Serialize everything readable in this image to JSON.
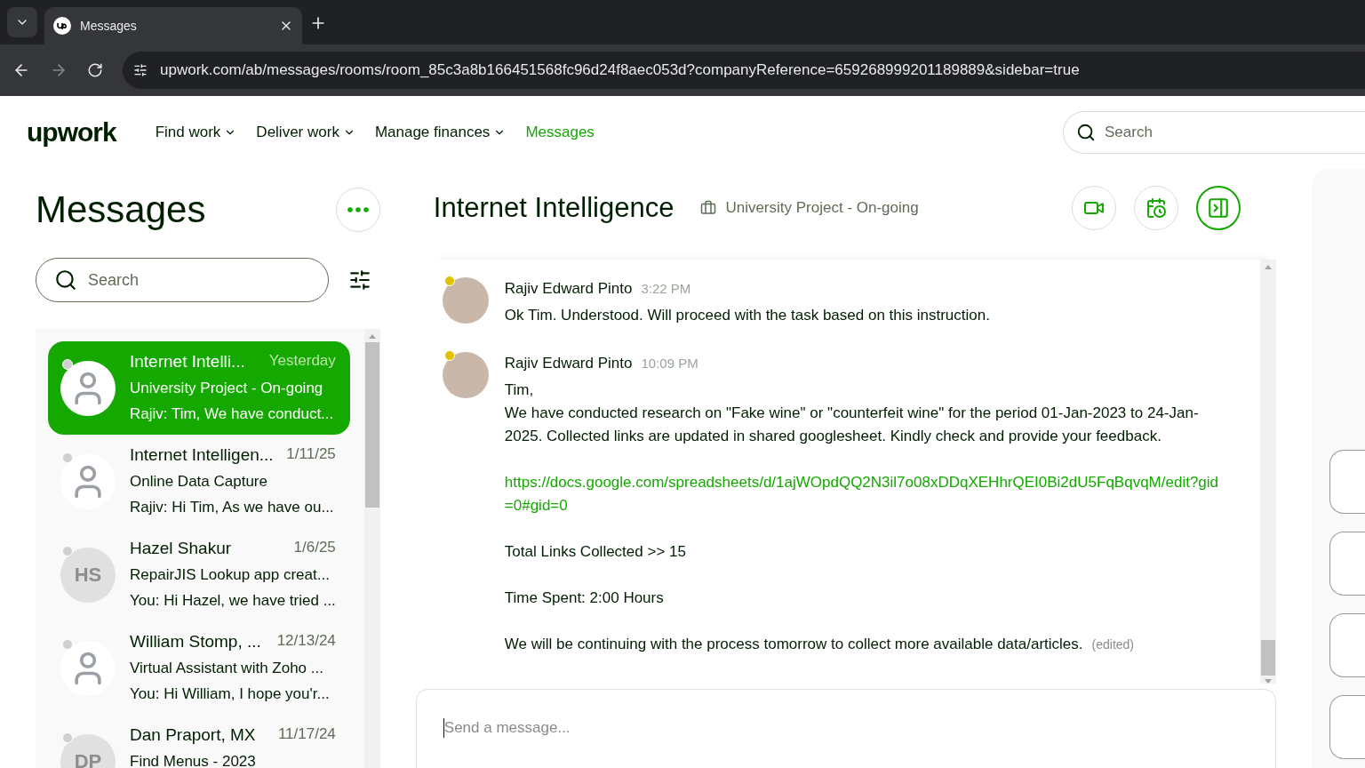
{
  "browser": {
    "tab_title": "Messages",
    "url": "upwork.com/ab/messages/rooms/room_85c3a8b166451568fc96d24f8aec053d?companyReference=659268999201189889&sidebar=true"
  },
  "nav": {
    "logo": "upwork",
    "items": [
      {
        "label": "Find work",
        "dropdown": true,
        "selected": false
      },
      {
        "label": "Deliver work",
        "dropdown": true,
        "selected": false
      },
      {
        "label": "Manage finances",
        "dropdown": true,
        "selected": false
      },
      {
        "label": "Messages",
        "dropdown": false,
        "selected": true
      }
    ],
    "search_placeholder": "Search"
  },
  "sidebar": {
    "title": "Messages",
    "search_placeholder": "Search",
    "conversations": [
      {
        "name": "Internet Intelli...",
        "date": "Yesterday",
        "title": "University Project - On-going",
        "preview": "Rajiv: Tim, We have conduct...",
        "selected": true,
        "avatar": {
          "kind": "photo"
        }
      },
      {
        "name": "Internet Intelligen...",
        "date": "1/11/25",
        "title": "Online Data Capture",
        "preview": "Rajiv: Hi Tim, As we have ou...",
        "selected": false,
        "avatar": {
          "kind": "photo"
        }
      },
      {
        "name": "Hazel Shakur",
        "date": "1/6/25",
        "title": "RepairJIS Lookup app creat...",
        "preview": "You: Hi Hazel, we have tried ...",
        "selected": false,
        "avatar": {
          "kind": "initials",
          "initials": "HS"
        }
      },
      {
        "name": "William Stomp, ...",
        "date": "12/13/24",
        "title": "Virtual Assistant with Zoho ...",
        "preview": "You: Hi William, I hope you'r...",
        "selected": false,
        "avatar": {
          "kind": "photo"
        }
      },
      {
        "name": "Dan Praport, MX",
        "date": "11/17/24",
        "title": "Find Menus - 2023",
        "selected": false,
        "avatar": {
          "kind": "initials",
          "initials": "DP"
        }
      }
    ]
  },
  "room": {
    "title": "Internet Intelligence",
    "project": "University Project - On-going",
    "messages": [
      {
        "sender": "Rajiv Edward Pinto",
        "time": "3:22 PM",
        "blocks": [
          {
            "kind": "text",
            "lines": [
              "Ok Tim. Understood. Will proceed with the task based on this instruction."
            ]
          }
        ]
      },
      {
        "sender": "Rajiv Edward Pinto",
        "time": "10:09 PM",
        "edited_label": "(edited)",
        "blocks": [
          {
            "kind": "text",
            "lines": [
              "Tim,",
              "We have conducted research on \"Fake wine\" or \"counterfeit wine\" for the period 01-Jan-2023 to 24-Jan-2025. Collected links are updated in shared googlesheet. Kindly check and provide your feedback."
            ]
          },
          {
            "kind": "link",
            "lines": [
              "https://docs.google.com/spreadsheets/d/1ajWOpdQQ2N3il7o08xDDqXEHhrQEI0Bi2dU5FqBqvqM/edit?gid=0#gid=0"
            ]
          },
          {
            "kind": "text",
            "lines": [
              "Total Links Collected >> 15"
            ]
          },
          {
            "kind": "text",
            "lines": [
              "Time Spent: 2:00 Hours"
            ]
          },
          {
            "kind": "text",
            "lines": [
              "We will be continuing with the process tomorrow to collect more available data/articles."
            ]
          }
        ]
      }
    ]
  },
  "composer": {
    "placeholder": "Send a message..."
  }
}
